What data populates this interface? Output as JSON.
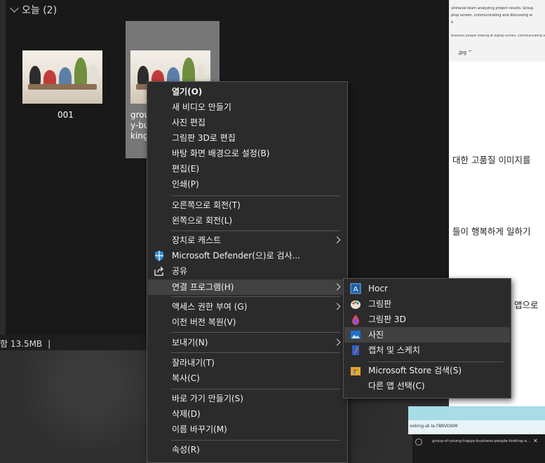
{
  "explorer": {
    "group_header": "오늘 (2)",
    "files": [
      {
        "name": "001"
      },
      {
        "name_lines": [
          "grou",
          "y-bu",
          "king"
        ]
      }
    ],
    "status": "함 13.5MB"
  },
  "document": {
    "header_lines": [
      "ultiracial team analyzing project results. Group",
      "ptop screen, communicating and discussing w",
      "e"
    ],
    "subheader": "business people looking at laptop screen, communicating and",
    "tab_label": ".jpg",
    "text1": "대한 고품질 이미지를",
    "text2": "들이 행복하게 일하기",
    "text3": "앱으로",
    "url_fragment": "ooking-at-la-T8BVDWM",
    "taskbar_title": "group-of-young-happy-business-people-looking-a..."
  },
  "context_menu": {
    "items": [
      {
        "label": "열기(O)",
        "bold": true
      },
      {
        "label": "새 비디오 만들기"
      },
      {
        "label": "사진 편집"
      },
      {
        "label": "그림판 3D로 편집"
      },
      {
        "label": "바탕 화면 배경으로 설정(B)"
      },
      {
        "label": "편집(E)"
      },
      {
        "label": "인쇄(P)"
      },
      {
        "label": "오른쪽으로 회전(T)"
      },
      {
        "label": "왼쪽으로 회전(L)"
      },
      {
        "label": "장치로 캐스트",
        "submenu": true
      },
      {
        "label": "Microsoft Defender(으)로 검사...",
        "icon": "defender-shield-icon"
      },
      {
        "label": "공유",
        "icon": "share-icon"
      },
      {
        "label": "연결 프로그램(H)",
        "submenu": true,
        "highlighted": true
      },
      {
        "label": "액세스 권한 부여 (G)",
        "submenu": true
      },
      {
        "label": "이전 버전 복원(V)"
      },
      {
        "label": "보내기(N)",
        "submenu": true
      },
      {
        "label": "잘라내기(T)"
      },
      {
        "label": "복사(C)"
      },
      {
        "label": "바로 가기 만들기(S)"
      },
      {
        "label": "삭제(D)"
      },
      {
        "label": "이름 바꾸기(M)"
      },
      {
        "label": "속성(R)"
      }
    ]
  },
  "open_with_submenu": {
    "items": [
      {
        "label": "Hocr",
        "icon": "hocr-icon"
      },
      {
        "label": "그림판",
        "icon": "paint-icon"
      },
      {
        "label": "그림판 3D",
        "icon": "paint3d-icon"
      },
      {
        "label": "사진",
        "icon": "photos-icon",
        "highlighted": true
      },
      {
        "label": "캡처 및 스케치",
        "icon": "snip-sketch-icon"
      },
      {
        "label": "Microsoft Store 검색(S)",
        "icon": "store-icon"
      },
      {
        "label": "다른 앱 선택(C)"
      }
    ]
  },
  "colors": {
    "menu_bg": "#2b2b2b",
    "highlight": "#414141",
    "explorer_bg": "#191919"
  }
}
